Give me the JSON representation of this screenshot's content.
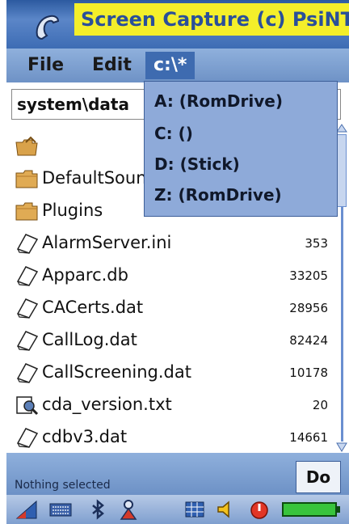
{
  "window": {
    "caption": "Screen Capture (c) PsiNT"
  },
  "menubar": {
    "file_label": "File",
    "edit_label": "Edit",
    "drive_label": "c:\\*"
  },
  "path": {
    "value": "system\\data"
  },
  "drive_menu": {
    "options": [
      {
        "label": "A: (RomDrive)"
      },
      {
        "label": "C: ()"
      },
      {
        "label": "D: (Stick)"
      },
      {
        "label": "Z: (RomDrive)"
      }
    ]
  },
  "files": [
    {
      "name": "",
      "size": "",
      "icon": "folder-up-icon"
    },
    {
      "name": "DefaultSound",
      "size": "",
      "icon": "folder-icon"
    },
    {
      "name": "Plugins",
      "size": "",
      "icon": "folder-icon"
    },
    {
      "name": "AlarmServer.ini",
      "size": "353",
      "icon": "document-icon"
    },
    {
      "name": "Apparc.db",
      "size": "33205",
      "icon": "document-icon"
    },
    {
      "name": "CACerts.dat",
      "size": "28956",
      "icon": "document-icon"
    },
    {
      "name": "CallLog.dat",
      "size": "82424",
      "icon": "document-icon"
    },
    {
      "name": "CallScreening.dat",
      "size": "10178",
      "icon": "document-icon"
    },
    {
      "name": "cda_version.txt",
      "size": "20",
      "icon": "text-file-icon"
    },
    {
      "name": "cdbv3.dat",
      "size": "14661",
      "icon": "document-icon"
    }
  ],
  "status": {
    "text": "Nothing selected",
    "do_label": "Do"
  },
  "colors": {
    "accent": "#3e6bb0",
    "caption_bg": "#f4ef2a",
    "menu_bg": "#8eaad9"
  }
}
